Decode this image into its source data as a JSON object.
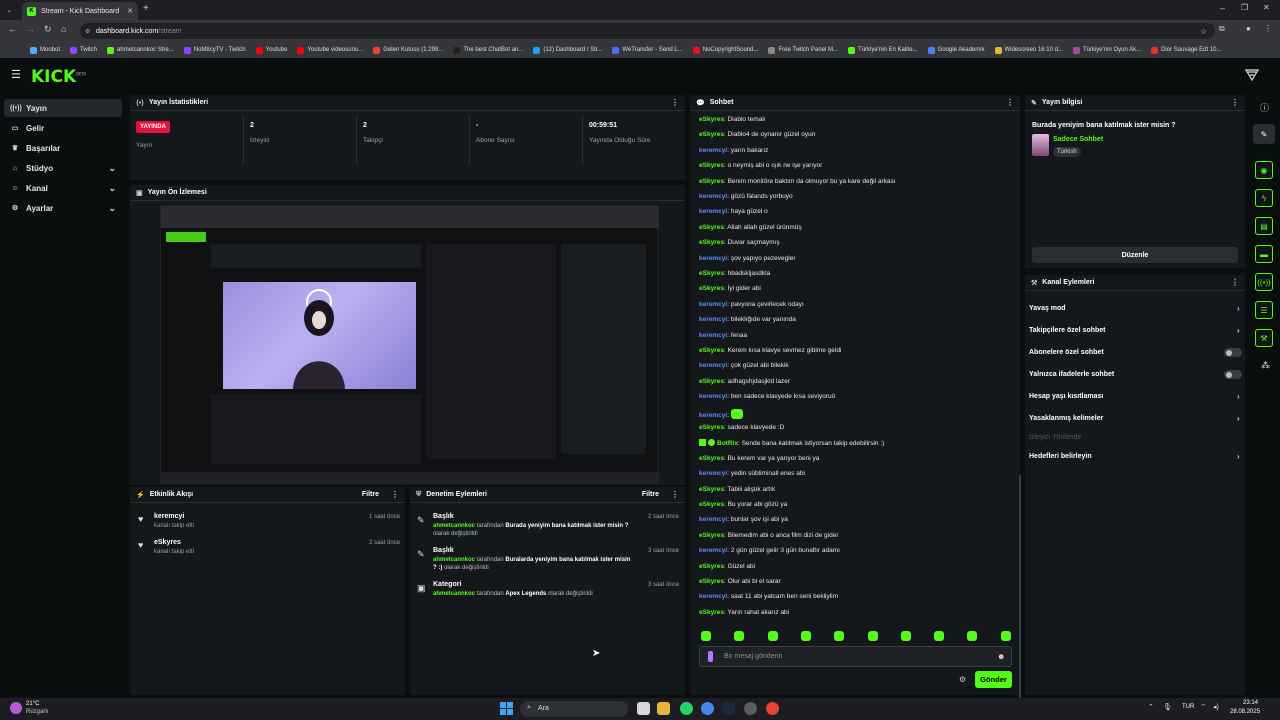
{
  "browser": {
    "tab_title": "Stream - Kick Dashboard",
    "url_host": "dashboard.kick.com",
    "url_path": "/stream",
    "bookmarks": [
      "Moobot",
      "Twitch",
      "ahmetcannkoc Stre...",
      "NoM8cyTV - Twitch",
      "Youtube",
      "Youtube videosunu...",
      "Gelen Kutusu (1.299...",
      "The best ChatBot an...",
      "(12) Dashboard / Str...",
      "WeTransfer - Send L...",
      "NoCopyrightSound...",
      "Free Twitch Panel M...",
      "Türkiye'nin En Kalite...",
      "Google Akademik",
      "Widescreen 16:10 d...",
      "Türkiye'nin Oyun Ak...",
      "Dior Sauvage Edt 10..."
    ]
  },
  "header": {
    "logo": "KICK",
    "logo_sup": "BETA"
  },
  "nav": [
    {
      "label": "Yayın",
      "icon": "broadcast-icon"
    },
    {
      "label": "Gelir",
      "icon": "wallet-icon"
    },
    {
      "label": "Başarılar",
      "icon": "trophy-icon"
    },
    {
      "label": "Stüdyo",
      "icon": "studio-icon"
    },
    {
      "label": "Kanal",
      "icon": "user-icon"
    },
    {
      "label": "Ayarlar",
      "icon": "gear-icon"
    }
  ],
  "stats": {
    "title": "Yayın İstatistikleri",
    "live_badge": "YAYINDA",
    "live_label": "Yayın",
    "items": [
      {
        "value": "2",
        "label": "İzleyici"
      },
      {
        "value": "2",
        "label": "Takipçi"
      },
      {
        "value": "-",
        "label": "Abone Sayısı"
      },
      {
        "value": "00:59:51",
        "label": "Yayında Olduğu Süre"
      }
    ]
  },
  "preview": {
    "title": "Yayın Ön İzlemesi"
  },
  "activity": {
    "title": "Etkinlik Akışı",
    "filter": "Filtre",
    "items": [
      {
        "name": "keremcyi",
        "sub": "kanalı takip etti",
        "time": "1 saat önce"
      },
      {
        "name": "eSkyres",
        "sub": "kanalı takip etti",
        "time": "2 saat önce"
      }
    ]
  },
  "moderation": {
    "title": "Denetim Eylemleri",
    "filter": "Filtre",
    "items": [
      {
        "title": "Başlık",
        "user": "ahmetcannkoc",
        "mid": " tarafından ",
        "bold": "Burada yeniyim bana katılmak ister misin ?",
        "end": " olarak değiştirildi",
        "time": "2 saat önce"
      },
      {
        "title": "Başlık",
        "user": "ahmetcannkoc",
        "mid": " tarafından ",
        "bold": "Buralarda yeniyim bana katılmak ister misin ? :)",
        "end": " olarak değiştirildi",
        "time": "3 saat önce"
      },
      {
        "title": "Kategori",
        "user": "ahmetcannkoc",
        "mid": " tarafından ",
        "bold": "Apex Legends",
        "end": " olarak değiştirildi",
        "time": "3 saat önce"
      }
    ]
  },
  "chat": {
    "title": "Sohbet",
    "messages": [
      {
        "u": "eSkyres",
        "t": "Diablo temalı",
        "c": 1
      },
      {
        "u": "eSkyres",
        "t": "Diablo4 de oynanır güzel oyun",
        "c": 1
      },
      {
        "u": "keremcyi",
        "t": "yarın bakarız",
        "c": 2
      },
      {
        "u": "eSkyres",
        "t": "o neymiş abi o ışık ne işe yarıyor",
        "c": 1
      },
      {
        "u": "eSkyres",
        "t": "Benim monitöre baktım da olmuyor bu ya kare değil arkası",
        "c": 1
      },
      {
        "u": "keremcyi",
        "t": "gözü falands yorbuyo",
        "c": 2
      },
      {
        "u": "keremcyi",
        "t": "haya güzel o",
        "c": 2
      },
      {
        "u": "eSkyres",
        "t": "Allah allah güzel ürünmüş",
        "c": 1
      },
      {
        "u": "eSkyres",
        "t": "Duvar saçmaymış",
        "c": 1
      },
      {
        "u": "keremcyi",
        "t": "şov yapıyo pezevegler",
        "c": 2
      },
      {
        "u": "eSkyres",
        "t": "hbadskljasdkla",
        "c": 1
      },
      {
        "u": "eSkyres",
        "t": "İyi gider abi",
        "c": 1
      },
      {
        "u": "keremcyi",
        "t": "pavyona çevirlecek odayı",
        "c": 2
      },
      {
        "u": "keremcyi",
        "t": "bileklığıde var yanında",
        "c": 2
      },
      {
        "u": "keremcyi",
        "t": "fenaa",
        "c": 2
      },
      {
        "u": "eSkyres",
        "t": "Kerem kısa klavye sevmez gibime geldi",
        "c": 1
      },
      {
        "u": "keremcyi",
        "t": "çok güzel abi bilekik",
        "c": 2
      },
      {
        "u": "eSkyres",
        "t": "adhagshjdasjkld lazer",
        "c": 1
      },
      {
        "u": "keremcyi",
        "t": "ben sadece klavyede kısa seviyoruö",
        "c": 2
      },
      {
        "u": "keremcyi",
        "t": "",
        "c": 2
      },
      {
        "u": "eSkyres",
        "t": "sadece klavyede :D",
        "c": 1
      },
      {
        "u": "BotRix",
        "t": "Sende bana katılmak istiyorsan takip edebilirsin :)",
        "c": 1
      },
      {
        "u": "eSkyres",
        "t": "Bu kerem var ya yarıyor beni ya",
        "c": 1
      },
      {
        "u": "keremcyi",
        "t": "yedin sübliminall enes abi",
        "c": 2
      },
      {
        "u": "eSkyres",
        "t": "Tabiii aliştık artık",
        "c": 1
      },
      {
        "u": "eSkyres",
        "t": "Bu yorar abi gözü ya",
        "c": 1
      },
      {
        "u": "keremcyi",
        "t": "bunlar şov işi abi ya",
        "c": 2
      },
      {
        "u": "eSkyres",
        "t": "Bilemedim abi o anca film dizi de gider",
        "c": 1
      },
      {
        "u": "keremcyi",
        "t": "2 gün güzel gelir 3 gün bunaltır adamı",
        "c": 2
      },
      {
        "u": "eSkyres",
        "t": "Güzel abi",
        "c": 1
      },
      {
        "u": "eSkyres",
        "t": "Olur abi bi el sarar",
        "c": 1
      },
      {
        "u": "keremcyi",
        "t": "saat 11 abi yatcam ben seni bekliylim",
        "c": 2
      },
      {
        "u": "eSkyres",
        "t": "Yarın rahat akarız abi",
        "c": 1
      }
    ],
    "placeholder": "Bir mesaj gönderin",
    "send": "Gönder"
  },
  "streaminfo": {
    "title": "Yayın bilgisi",
    "stream_title": "Burada yeniyim bana katılmak ister misin ?",
    "category": "Sadece Sohbet",
    "tag": "Türkish",
    "edit": "Düzenle"
  },
  "channel_actions": {
    "title": "Kanal Eylemleri",
    "items": [
      {
        "label": "Yavaş mod",
        "ctrl": "arrow"
      },
      {
        "label": "Takipçilere özel sohbet",
        "ctrl": "arrow"
      },
      {
        "label": "Abonelere özel sohbet",
        "ctrl": "toggle"
      },
      {
        "label": "Yalnızca ifadelerle sohbet",
        "ctrl": "toggle"
      },
      {
        "label": "Hesap yaşı kısıtlaması",
        "ctrl": "arrow"
      },
      {
        "label": "Yasaklanmış kelimeler",
        "ctrl": "arrow"
      },
      {
        "label": "İzleyici Yönlendir",
        "ctrl": "none"
      },
      {
        "label": "Hedefleri belirleyin",
        "ctrl": "arrow"
      }
    ]
  },
  "taskbar": {
    "weather_temp": "21°C",
    "weather_label": "Rüzgarlı",
    "search": "Ara",
    "lang": "TUR",
    "time": "23:14",
    "date": "28.08.2025"
  },
  "colors": {
    "accent": "#53fc18",
    "live": "#e0153b",
    "user_blue": "#5c8dff",
    "panel": "#15181b"
  }
}
